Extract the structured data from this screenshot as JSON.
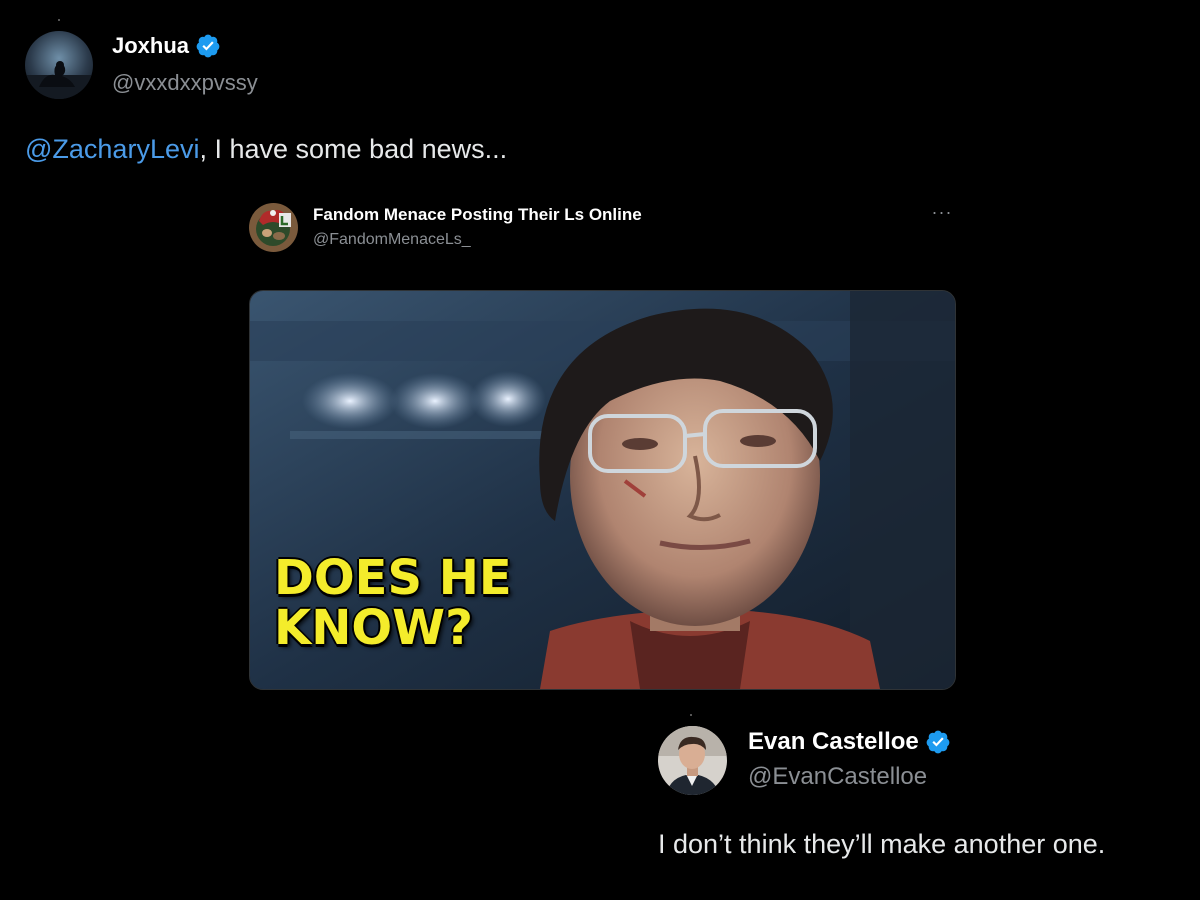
{
  "main_tweet": {
    "display_name": "Joxhua",
    "handle": "@vxxdxxpvssy",
    "mention": "@ZacharyLevi",
    "text_rest": ", I have some bad news...",
    "avatar_icon": "avatar-silhouette-icon"
  },
  "quoted_tweet": {
    "display_name": "Fandom Menace Posting Their Ls Online",
    "handle": "@FandomMenaceLs_",
    "more_label": "···",
    "media": {
      "caption_line1": "DOES HE",
      "caption_line2": "KNOW?"
    }
  },
  "reply_tweet": {
    "display_name": "Evan Castelloe",
    "handle": "@EvanCastelloe",
    "text": "I don’t think they’ll make another one."
  },
  "colors": {
    "background": "#000000",
    "mention": "#4b9be8",
    "verified": "#1d9bf0",
    "handle": "#8b8f94",
    "caption": "#f4ec2b"
  }
}
